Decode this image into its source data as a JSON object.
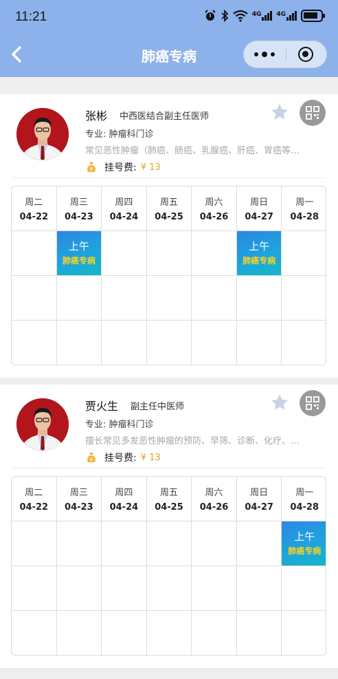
{
  "status_bar": {
    "time": "11:21",
    "net_label_1": "4G",
    "net_label_2": "4G"
  },
  "nav": {
    "title": "肺癌专病"
  },
  "colors": {
    "nav_bg": "#8db1ea",
    "slot_gradient_start": "#2d87e3",
    "slot_gradient_end": "#13b7c7",
    "slot_text": "#ffd21f",
    "fee": "#e8a217"
  },
  "doctors": [
    {
      "name": "张彬",
      "title": "中西医结合副主任医师",
      "specialty": "专业: 肿瘤科门诊",
      "description": "常见恶性肿瘤（肺癌、肠癌、乳腺癌、肝癌、胃癌等…",
      "fee_label": "挂号费:",
      "fee_value": "¥ 13",
      "days": [
        {
          "name": "周二",
          "date": "04-22",
          "slots": []
        },
        {
          "name": "周三",
          "date": "04-23",
          "slots": [
            {
              "row": 0,
              "time": "上午",
              "clinic": "肺癌专病"
            }
          ]
        },
        {
          "name": "周四",
          "date": "04-24",
          "slots": []
        },
        {
          "name": "周五",
          "date": "04-25",
          "slots": []
        },
        {
          "name": "周六",
          "date": "04-26",
          "slots": []
        },
        {
          "name": "周日",
          "date": "04-27",
          "slots": [
            {
              "row": 0,
              "time": "上午",
              "clinic": "肺癌专病"
            }
          ]
        },
        {
          "name": "周一",
          "date": "04-28",
          "slots": []
        }
      ]
    },
    {
      "name": "贾火生",
      "title": "副主任中医师",
      "specialty": "专业: 肿瘤科门诊",
      "description": "擅长常见多发恶性肿瘤的预防、早筛、诊断、化疗、…",
      "fee_label": "挂号费:",
      "fee_value": "¥ 13",
      "days": [
        {
          "name": "周二",
          "date": "04-22",
          "slots": []
        },
        {
          "name": "周三",
          "date": "04-23",
          "slots": []
        },
        {
          "name": "周四",
          "date": "04-24",
          "slots": []
        },
        {
          "name": "周五",
          "date": "04-25",
          "slots": []
        },
        {
          "name": "周六",
          "date": "04-26",
          "slots": []
        },
        {
          "name": "周日",
          "date": "04-27",
          "slots": []
        },
        {
          "name": "周一",
          "date": "04-28",
          "slots": [
            {
              "row": 0,
              "time": "上午",
              "clinic": "肺癌专病"
            }
          ]
        }
      ]
    }
  ]
}
